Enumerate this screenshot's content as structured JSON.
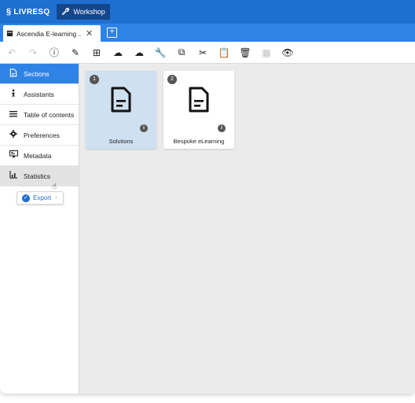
{
  "app": {
    "brand": "LIVRESQ",
    "workshop_label": "Workshop"
  },
  "tabs": [
    {
      "label": "Ascendia E-learning ...",
      "close": "✕"
    }
  ],
  "add_tab": "+",
  "toolbar": [
    {
      "name": "undo-button",
      "icon": "↶",
      "disabled": true
    },
    {
      "name": "redo-button",
      "icon": "↷",
      "disabled": true
    },
    {
      "name": "info-button",
      "icon": "ⓘ",
      "disabled": false
    },
    {
      "name": "edit-button",
      "icon": "✎",
      "disabled": false
    },
    {
      "name": "add-section-button",
      "icon": "⊞",
      "disabled": false
    },
    {
      "name": "cloud-download-button",
      "icon": "☁",
      "disabled": false
    },
    {
      "name": "cloud-upload-button",
      "icon": "☁",
      "disabled": false
    },
    {
      "name": "tools-button",
      "icon": "🔧",
      "disabled": false
    },
    {
      "name": "copy-button",
      "icon": "⧉",
      "disabled": false
    },
    {
      "name": "cut-button",
      "icon": "✂",
      "disabled": false
    },
    {
      "name": "paste-button",
      "icon": "📋",
      "disabled": true
    },
    {
      "name": "delete-button",
      "icon": "🗑",
      "disabled": false
    },
    {
      "name": "layout-button",
      "icon": "▦",
      "disabled": true
    },
    {
      "name": "preview-button",
      "icon": "👁",
      "disabled": false
    }
  ],
  "sidebar": {
    "items": [
      {
        "label": "Sections",
        "icon": "📄"
      },
      {
        "label": "Assistants",
        "icon": "🚶"
      },
      {
        "label": "Table of contents",
        "icon": "≡"
      },
      {
        "label": "Preferences",
        "icon": "⚙"
      },
      {
        "label": "Metadata",
        "icon": "🖥"
      },
      {
        "label": "Statistics",
        "icon": "📊"
      }
    ],
    "export_label": "Export"
  },
  "cards": [
    {
      "number": "1",
      "title": "Solutions",
      "info": "i"
    },
    {
      "number": "2",
      "title": "Bespoke eLearning",
      "info": "i"
    }
  ],
  "colors": {
    "topbar": "#1f6fd1",
    "tabbar": "#2f83e6",
    "active": "#2f83e6",
    "selected_card": "#cfe0f0"
  }
}
